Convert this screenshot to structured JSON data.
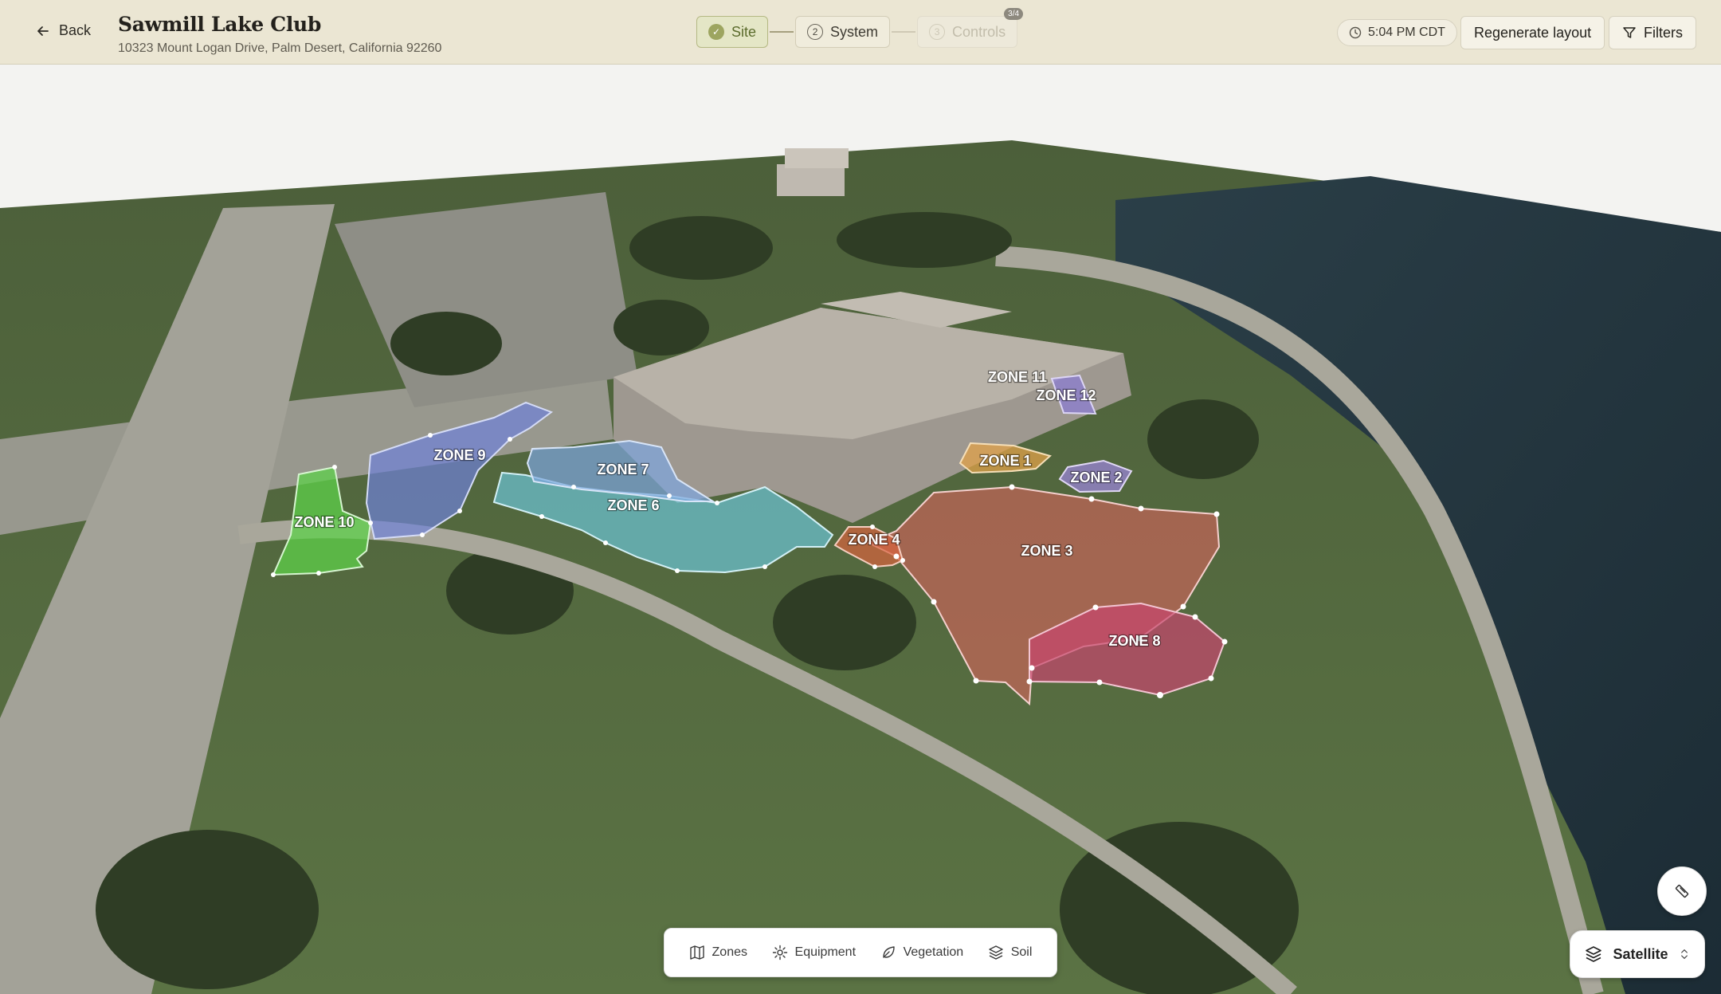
{
  "header": {
    "back_label": "Back",
    "title": "Sawmill Lake Club",
    "address": "10323 Mount Logan Drive, Palm Desert, California 92260",
    "time": "5:04 PM CDT",
    "regenerate_label": "Regenerate layout",
    "filters_label": "Filters"
  },
  "stepper": {
    "steps": [
      {
        "label": "Site",
        "state": "done",
        "number": ""
      },
      {
        "label": "System",
        "state": "active",
        "number": "2"
      },
      {
        "label": "Controls",
        "state": "pending",
        "number": "3"
      }
    ],
    "badge": "3/4"
  },
  "map": {
    "zones": [
      {
        "label": "ZONE 1",
        "color": "#e0a24a"
      },
      {
        "label": "ZONE 2",
        "color": "#9a84d6"
      },
      {
        "label": "ZONE 3",
        "color": "#d8645e"
      },
      {
        "label": "ZONE 4",
        "color": "#d8643e"
      },
      {
        "label": "ZONE 6",
        "color": "#6cc4d6"
      },
      {
        "label": "ZONE 7",
        "color": "#7ea6e0"
      },
      {
        "label": "ZONE 8",
        "color": "#c8466e"
      },
      {
        "label": "ZONE 9",
        "color": "#6f82d8"
      },
      {
        "label": "ZONE 10",
        "color": "#5ed04a"
      },
      {
        "label": "ZONE 11",
        "color": "#b8b2a6"
      },
      {
        "label": "ZONE 12",
        "color": "#8a7cd6"
      }
    ],
    "base_layer": "Satellite"
  },
  "palette": {
    "items": [
      {
        "label": "Zones",
        "icon": "map-icon"
      },
      {
        "label": "Equipment",
        "icon": "gear-icon"
      },
      {
        "label": "Vegetation",
        "icon": "leaf-icon"
      },
      {
        "label": "Soil",
        "icon": "layers-icon"
      }
    ]
  }
}
